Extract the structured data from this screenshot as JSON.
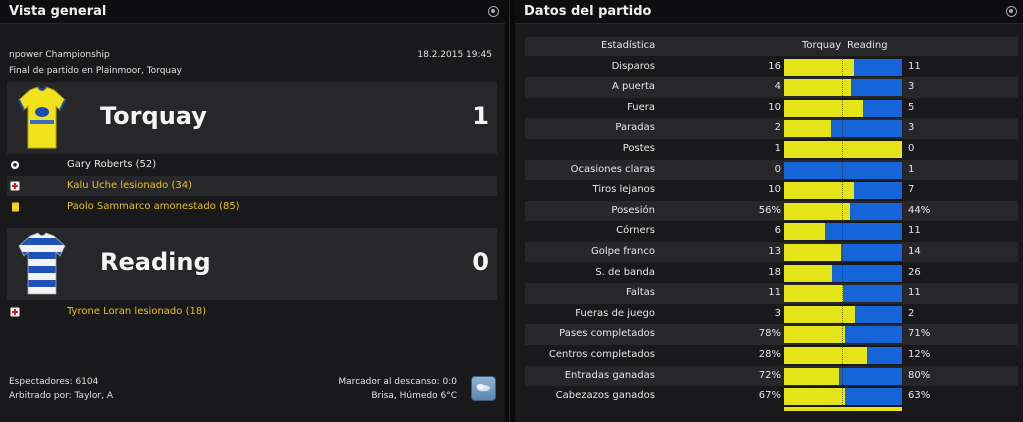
{
  "overview": {
    "title": "Vista general",
    "competition": "npower Championship",
    "datetime": "18.2.2015 19:45",
    "venue": "Final de partido en Plainmoor, Torquay",
    "home": {
      "name": "Torquay",
      "score": "1",
      "events": [
        {
          "icon": "goal-icon",
          "text": "Gary Roberts (52)",
          "color": "white"
        },
        {
          "icon": "injury-icon",
          "text": "Kalu Uche lesionado (34)",
          "color": "gold"
        },
        {
          "icon": "yellow-card-icon",
          "text": "Paolo Sammarco amonestado (85)",
          "color": "gold"
        }
      ]
    },
    "away": {
      "name": "Reading",
      "score": "0",
      "events": [
        {
          "icon": "injury-icon",
          "text": "Tyrone Loran lesionado (18)",
          "color": "gold"
        }
      ]
    },
    "attendance": "Espectadores: 6104",
    "referee": "Arbitrado por: Taylor, A",
    "halftime": "Marcador al descanso: 0:0",
    "weather": "Brisa, Húmedo 6°C"
  },
  "stats": {
    "title": "Datos del partido",
    "headers": {
      "stat": "Estadística",
      "home": "Torquay",
      "away": "Reading"
    },
    "rows": [
      {
        "label": "Disparos",
        "home": "16",
        "away": "11",
        "home_share": 0.59
      },
      {
        "label": "A puerta",
        "home": "4",
        "away": "3",
        "home_share": 0.57
      },
      {
        "label": "Fuera",
        "home": "10",
        "away": "5",
        "home_share": 0.67
      },
      {
        "label": "Paradas",
        "home": "2",
        "away": "3",
        "home_share": 0.4
      },
      {
        "label": "Postes",
        "home": "1",
        "away": "0",
        "home_share": 1.0
      },
      {
        "label": "Ocasiones claras",
        "home": "0",
        "away": "1",
        "home_share": 0.0
      },
      {
        "label": "Tiros lejanos",
        "home": "10",
        "away": "7",
        "home_share": 0.59
      },
      {
        "label": "Posesión",
        "home": "56%",
        "away": "44%",
        "home_share": 0.56
      },
      {
        "label": "Córners",
        "home": "6",
        "away": "11",
        "home_share": 0.35
      },
      {
        "label": "Golpe franco",
        "home": "13",
        "away": "14",
        "home_share": 0.48
      },
      {
        "label": "S. de banda",
        "home": "18",
        "away": "26",
        "home_share": 0.41
      },
      {
        "label": "Faltas",
        "home": "11",
        "away": "11",
        "home_share": 0.5
      },
      {
        "label": "Fueras de juego",
        "home": "3",
        "away": "2",
        "home_share": 0.6
      },
      {
        "label": "Pases completados",
        "home": "78%",
        "away": "71%",
        "home_share": 0.52
      },
      {
        "label": "Centros completados",
        "home": "28%",
        "away": "12%",
        "home_share": 0.7
      },
      {
        "label": "Entradas ganadas",
        "home": "72%",
        "away": "80%",
        "home_share": 0.47
      },
      {
        "label": "Cabezazos ganados",
        "home": "67%",
        "away": "63%",
        "home_share": 0.52
      }
    ]
  },
  "colors": {
    "home_bar": "#e4e419",
    "away_bar": "#1565d8",
    "event_highlight": "#e8c020"
  }
}
